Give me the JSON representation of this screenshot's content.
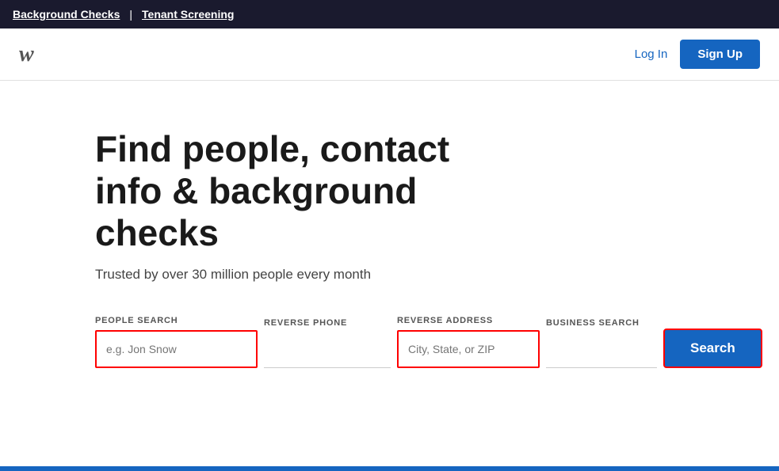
{
  "topbar": {
    "link1": "Background Checks",
    "divider": "|",
    "link2": "Tenant Screening"
  },
  "header": {
    "logo": "w",
    "login_label": "Log In",
    "signup_label": "Sign Up"
  },
  "hero": {
    "title": "Find people, contact info & background checks",
    "subtitle": "Trusted by over 30 million people every month"
  },
  "search": {
    "people_search_label": "PEOPLE SEARCH",
    "people_search_placeholder": "e.g. Jon Snow",
    "reverse_phone_label": "REVERSE PHONE",
    "reverse_phone_placeholder": "",
    "reverse_address_label": "REVERSE ADDRESS",
    "reverse_address_placeholder": "City, State, or ZIP",
    "business_search_label": "BUSINESS SEARCH",
    "business_search_placeholder": "",
    "search_button_label": "Search"
  }
}
